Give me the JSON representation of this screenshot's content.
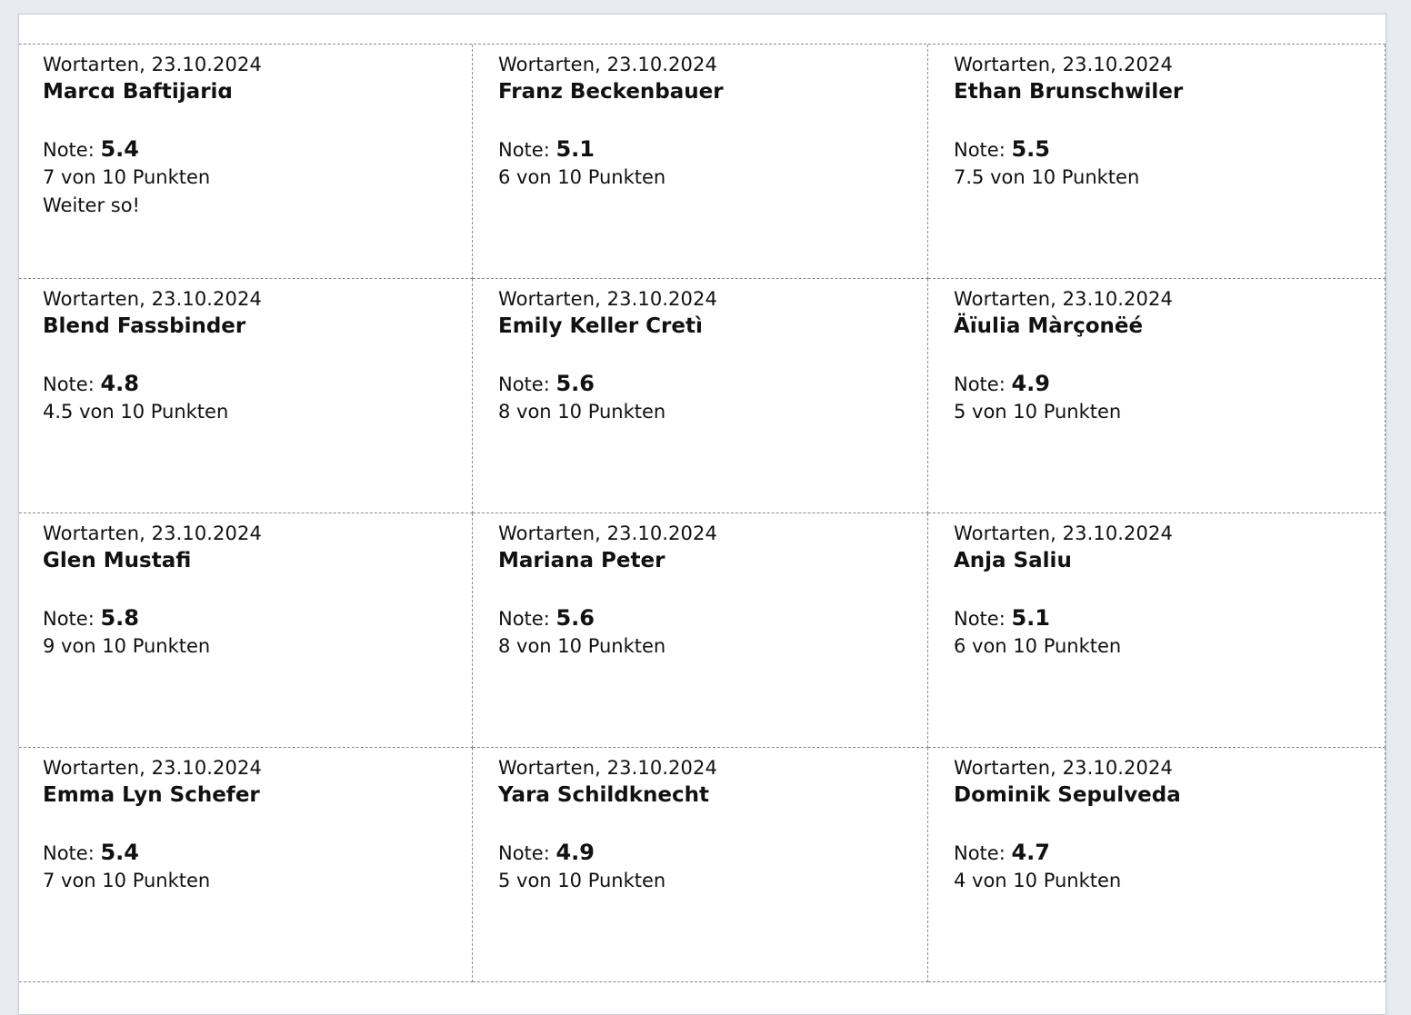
{
  "cards": [
    {
      "header": "Wortarten, 23.10.2024",
      "name": "Marcɑ Baftijariɑ",
      "note_label": "Note:",
      "grade": "5.4",
      "points": "7 von 10 Punkten",
      "comment": "Weiter so!"
    },
    {
      "header": "Wortarten, 23.10.2024",
      "name": "Franz Beckenbauer",
      "note_label": "Note:",
      "grade": "5.1",
      "points": "6 von 10 Punkten",
      "comment": ""
    },
    {
      "header": "Wortarten, 23.10.2024",
      "name": "Ethan Brunschwiler",
      "note_label": "Note:",
      "grade": "5.5",
      "points": "7.5 von 10 Punkten",
      "comment": ""
    },
    {
      "header": "Wortarten, 23.10.2024",
      "name": "Blend Fassbinder",
      "note_label": "Note:",
      "grade": "4.8",
      "points": "4.5 von 10 Punkten",
      "comment": ""
    },
    {
      "header": "Wortarten, 23.10.2024",
      "name": "Emily Keller Cretì",
      "note_label": "Note:",
      "grade": "5.6",
      "points": "8 von 10 Punkten",
      "comment": ""
    },
    {
      "header": "Wortarten, 23.10.2024",
      "name": "Äïulia Màrçonëé",
      "note_label": "Note:",
      "grade": "4.9",
      "points": "5 von 10 Punkten",
      "comment": ""
    },
    {
      "header": "Wortarten, 23.10.2024",
      "name": "Glen Mustafi",
      "note_label": "Note:",
      "grade": "5.8",
      "points": "9 von 10 Punkten",
      "comment": ""
    },
    {
      "header": "Wortarten, 23.10.2024",
      "name": "Mariana Peter",
      "note_label": "Note:",
      "grade": "5.6",
      "points": "8 von 10 Punkten",
      "comment": ""
    },
    {
      "header": "Wortarten, 23.10.2024",
      "name": "Anja Saliu",
      "note_label": "Note:",
      "grade": "5.1",
      "points": "6 von 10 Punkten",
      "comment": ""
    },
    {
      "header": "Wortarten, 23.10.2024",
      "name": "Emma Lyn Schefer",
      "note_label": "Note:",
      "grade": "5.4",
      "points": "7 von 10 Punkten",
      "comment": ""
    },
    {
      "header": "Wortarten, 23.10.2024",
      "name": "Yara Schildknecht",
      "note_label": "Note:",
      "grade": "4.9",
      "points": "5 von 10 Punkten",
      "comment": ""
    },
    {
      "header": "Wortarten, 23.10.2024",
      "name": "Dominik Sepulveda",
      "note_label": "Note:",
      "grade": "4.7",
      "points": "4 von 10 Punkten",
      "comment": ""
    }
  ]
}
